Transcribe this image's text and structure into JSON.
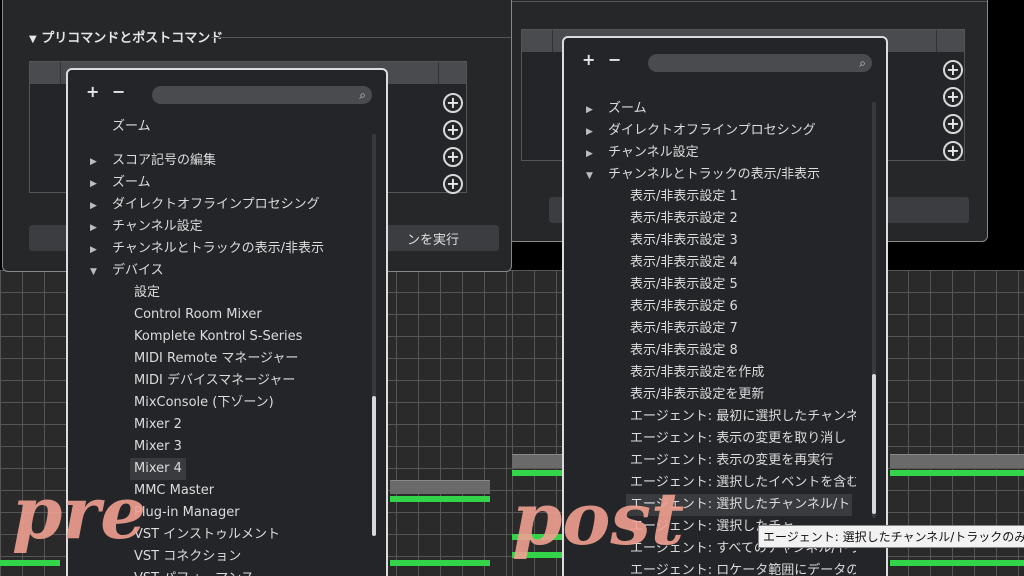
{
  "left": {
    "section_title": "プリコマンドとポストコマンド",
    "run_button_label": "ンを実行",
    "popup": {
      "plus": "+",
      "minus": "−",
      "items": [
        {
          "label": "ズーム",
          "type": "cut"
        },
        {
          "label": "スコア記号の編集",
          "type": "folder"
        },
        {
          "label": "ズーム",
          "type": "folder"
        },
        {
          "label": "ダイレクトオフラインプロセシング",
          "type": "folder"
        },
        {
          "label": "チャンネル設定",
          "type": "folder"
        },
        {
          "label": "チャンネルとトラックの表示/非表示",
          "type": "folder"
        },
        {
          "label": "デバイス",
          "type": "open"
        },
        {
          "label": "設定",
          "type": "child"
        },
        {
          "label": "Control Room Mixer",
          "type": "child"
        },
        {
          "label": "Komplete Kontrol S-Series",
          "type": "child"
        },
        {
          "label": "MIDI Remote マネージャー",
          "type": "child"
        },
        {
          "label": "MIDI デバイスマネージャー",
          "type": "child"
        },
        {
          "label": "MixConsole (下ゾーン)",
          "type": "child"
        },
        {
          "label": "Mixer 2",
          "type": "child"
        },
        {
          "label": "Mixer 3",
          "type": "child"
        },
        {
          "label": "Mixer 4",
          "type": "child",
          "selected": true
        },
        {
          "label": "MMC Master",
          "type": "child"
        },
        {
          "label": "Plug-in Manager",
          "type": "child"
        },
        {
          "label": "VST インストゥルメント",
          "type": "child"
        },
        {
          "label": "VST コネクション",
          "type": "child"
        },
        {
          "label": "VST パフォーマンス",
          "type": "child"
        }
      ]
    },
    "watermark": "pre"
  },
  "right": {
    "popup": {
      "plus": "+",
      "minus": "−",
      "items": [
        {
          "label": "ズーム",
          "type": "folder"
        },
        {
          "label": "ダイレクトオフラインプロセシング",
          "type": "folder"
        },
        {
          "label": "チャンネル設定",
          "type": "folder"
        },
        {
          "label": "チャンネルとトラックの表示/非表示",
          "type": "open"
        },
        {
          "label": "表示/非表示設定 1",
          "type": "child"
        },
        {
          "label": "表示/非表示設定 2",
          "type": "child"
        },
        {
          "label": "表示/非表示設定 3",
          "type": "child"
        },
        {
          "label": "表示/非表示設定 4",
          "type": "child"
        },
        {
          "label": "表示/非表示設定 5",
          "type": "child"
        },
        {
          "label": "表示/非表示設定 6",
          "type": "child"
        },
        {
          "label": "表示/非表示設定 7",
          "type": "child"
        },
        {
          "label": "表示/非表示設定 8",
          "type": "child"
        },
        {
          "label": "表示/非表示設定を作成",
          "type": "child"
        },
        {
          "label": "表示/非表示設定を更新",
          "type": "child"
        },
        {
          "label": "エージェント: 最初に選択したチャンネルと接続",
          "type": "child"
        },
        {
          "label": "エージェント: 表示の変更を取り消し",
          "type": "child"
        },
        {
          "label": "エージェント: 表示の変更を再実行",
          "type": "child"
        },
        {
          "label": "エージェント: 選択したイベントを含むトラックを",
          "type": "child"
        },
        {
          "label": "エージェント: 選択したチャンネル/トラックのみ",
          "type": "child",
          "selected": true
        },
        {
          "label": "エージェント: 選択したチャ",
          "type": "child"
        },
        {
          "label": "エージェント: すべてのチャンネル/トラックを表",
          "type": "child"
        },
        {
          "label": "エージェント: ロケータ範囲にデータのあるチ",
          "type": "child"
        }
      ]
    },
    "tooltip": "エージェント: 選択したチャンネル/トラックのみを表示",
    "watermark": "post"
  }
}
